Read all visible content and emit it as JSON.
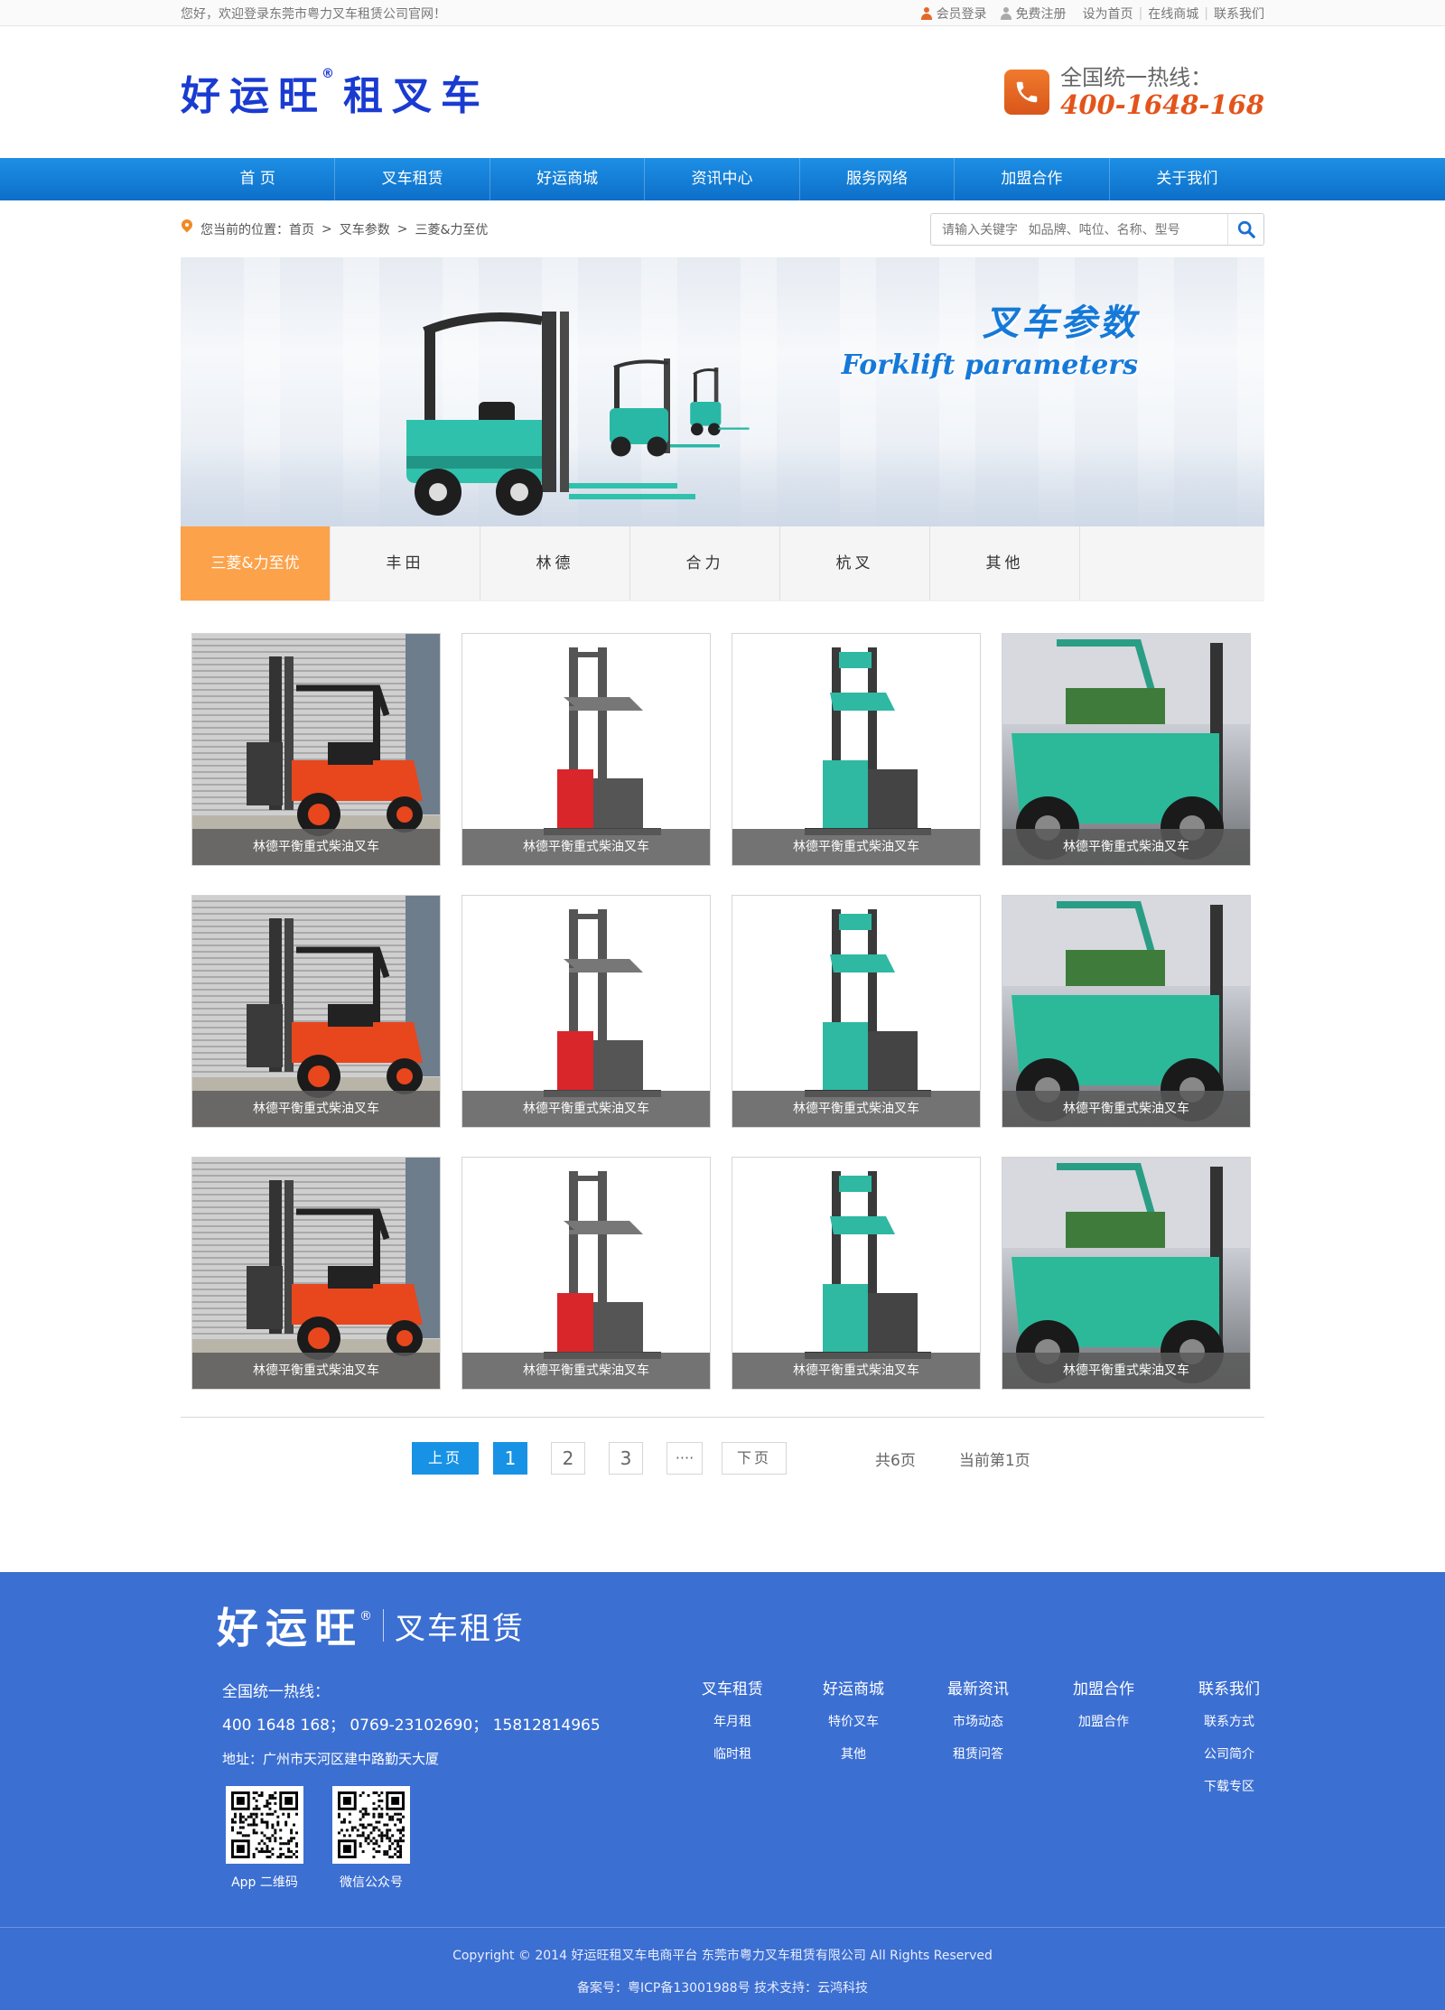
{
  "topbar": {
    "welcome": "您好，欢迎登录东莞市粤力叉车租赁公司官网！",
    "login": "会员登录",
    "register": "免费注册",
    "links": [
      "设为首页",
      "在线商城",
      "联系我们"
    ]
  },
  "header": {
    "logo_main": "好运旺",
    "logo_mark": "®",
    "logo_sub": "租叉车",
    "hotline_label": "全国统一热线：",
    "hotline_number": "400-1648-168"
  },
  "nav": [
    "首 页",
    "叉车租赁",
    "好运商城",
    "资讯中心",
    "服务网络",
    "加盟合作",
    "关于我们"
  ],
  "breadcrumb": {
    "prefix": "您当前的位置：",
    "items": [
      "首页",
      ">",
      "叉车参数",
      ">",
      "三菱&力至优"
    ]
  },
  "search": {
    "placeholder": "请输入关键字   如品牌、吨位、名称、型号"
  },
  "banner": {
    "title_cn": "叉车参数",
    "title_en": "Forklift parameters"
  },
  "brand_tabs": [
    "三菱&力至优",
    "丰田",
    "林德",
    "合力",
    "杭叉",
    "其他"
  ],
  "products": [
    {
      "caption": "林德平衡重式柴油叉车",
      "photo": "orange-diesel-forklift"
    },
    {
      "caption": "林德平衡重式柴油叉车",
      "photo": "red-reach-truck"
    },
    {
      "caption": "林德平衡重式柴油叉车",
      "photo": "green-reach-truck"
    },
    {
      "caption": "林德平衡重式柴油叉车",
      "photo": "green-counterbalance-forklift"
    },
    {
      "caption": "林德平衡重式柴油叉车",
      "photo": "orange-diesel-forklift"
    },
    {
      "caption": "林德平衡重式柴油叉车",
      "photo": "red-reach-truck"
    },
    {
      "caption": "林德平衡重式柴油叉车",
      "photo": "green-reach-truck"
    },
    {
      "caption": "林德平衡重式柴油叉车",
      "photo": "green-counterbalance-forklift"
    },
    {
      "caption": "林德平衡重式柴油叉车",
      "photo": "orange-diesel-forklift"
    },
    {
      "caption": "林德平衡重式柴油叉车",
      "photo": "red-reach-truck"
    },
    {
      "caption": "林德平衡重式柴油叉车",
      "photo": "green-reach-truck"
    },
    {
      "caption": "林德平衡重式柴油叉车",
      "photo": "green-counterbalance-forklift"
    }
  ],
  "pagination": {
    "prev": "上页",
    "pages": [
      "1",
      "2",
      "3"
    ],
    "ellipsis": "····",
    "next": "下页",
    "total": "共6页",
    "current": "当前第1页"
  },
  "footer": {
    "logo_main": "好运旺",
    "logo_mark": "®",
    "logo_sub": "叉车租赁",
    "hotline_label": "全国统一热线：",
    "phones": "400 1648 168； 0769-23102690； 15812814965",
    "address": "地址：广州市天河区建中路勤天大厦",
    "qr": [
      {
        "label": "App 二维码"
      },
      {
        "label": "微信公众号"
      }
    ],
    "columns": [
      {
        "heading": "叉车租赁",
        "items": [
          "年月租",
          "临时租"
        ]
      },
      {
        "heading": "好运商城",
        "items": [
          "特价叉车",
          "其他"
        ]
      },
      {
        "heading": "最新资讯",
        "items": [
          "市场动态",
          "租赁问答"
        ]
      },
      {
        "heading": "加盟合作",
        "items": [
          "加盟合作"
        ]
      },
      {
        "heading": "联系我们",
        "items": [
          "联系方式",
          "公司简介",
          "下载专区"
        ]
      }
    ],
    "copyright": "Copyright © 2014 好运旺租叉车电商平台 东莞市粤力叉车租赁有限公司 All Rights Reserved",
    "icp": "备案号：粤ICP备13001988号  技术支持：云鸿科技"
  },
  "colors": {
    "nav_blue": "#0d6fc9",
    "accent_orange": "#fca24a",
    "hotline_red": "#e3541b",
    "footer_blue": "#3c6fd2",
    "pager_blue": "#1792e5"
  }
}
